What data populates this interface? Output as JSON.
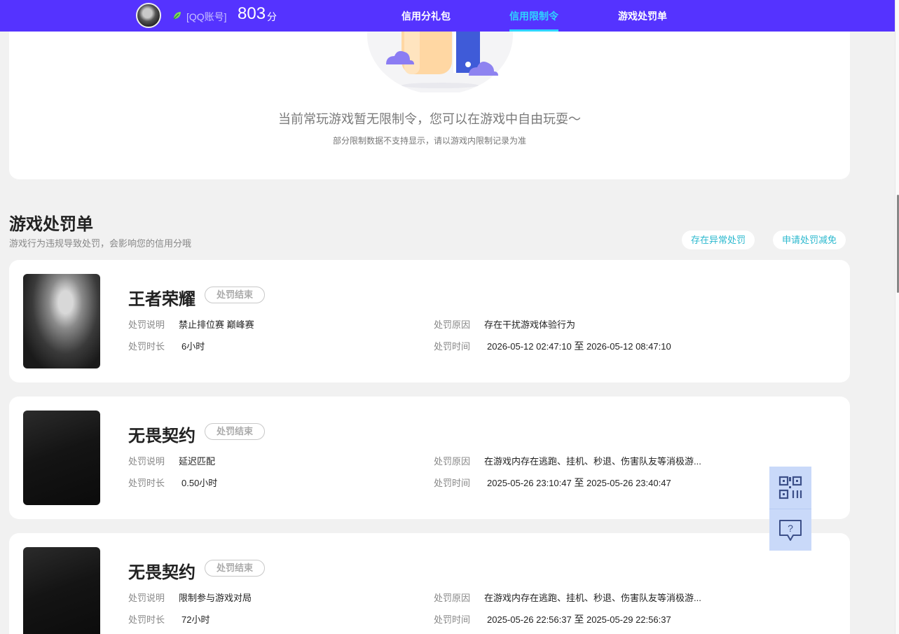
{
  "header": {
    "account_label": "[QQ账号]",
    "score": "803",
    "score_unit": "分",
    "tabs": [
      {
        "label": "信用分礼包",
        "active": false
      },
      {
        "label": "信用限制令",
        "active": true
      },
      {
        "label": "游戏处罚单",
        "active": false
      }
    ],
    "bg_color": "#5533ff",
    "active_color": "#2fd5ff"
  },
  "restriction": {
    "empty_main": "当前常玩游戏暂无限制令，您可以在游戏中自由玩耍～",
    "empty_sub": "部分限制数据不支持显示，请以游戏内限制记录为准"
  },
  "penalty": {
    "title": "游戏处罚单",
    "subtitle": "游戏行为违规导致处罚，会影响您的信用分哦",
    "btn_abnormal": "存在异常处罚",
    "btn_appeal": "申请处罚减免",
    "labels": {
      "desc": "处罚说明",
      "reason": "处罚原因",
      "duration": "处罚时长",
      "time": "处罚时间",
      "to": "至"
    },
    "items": [
      {
        "game": "王者荣耀",
        "status": "处罚结束",
        "desc": "禁止排位赛 巅峰赛",
        "reason": "存在干扰游戏体验行为",
        "duration": "6小时",
        "start": "2026-05-12 02:47:10",
        "end": "2026-05-12 08:47:10"
      },
      {
        "game": "无畏契约",
        "status": "处罚结束",
        "desc": "延迟匹配",
        "reason": "在游戏内存在逃跑、挂机、秒退、伤害队友等消极游...",
        "duration": "0.50小时",
        "start": "2025-05-26 23:10:47",
        "end": "2025-05-26 23:40:47"
      },
      {
        "game": "无畏契约",
        "status": "处罚结束",
        "desc": "限制参与游戏对局",
        "reason": "在游戏内存在逃跑、挂机、秒退、伤害队友等消极游...",
        "duration": "72小时",
        "start": "2025-05-26 22:56:37",
        "end": "2025-05-29 22:56:37"
      }
    ]
  },
  "float_tools": {
    "icons": [
      "qrcode-icon",
      "help-chat-icon"
    ]
  }
}
